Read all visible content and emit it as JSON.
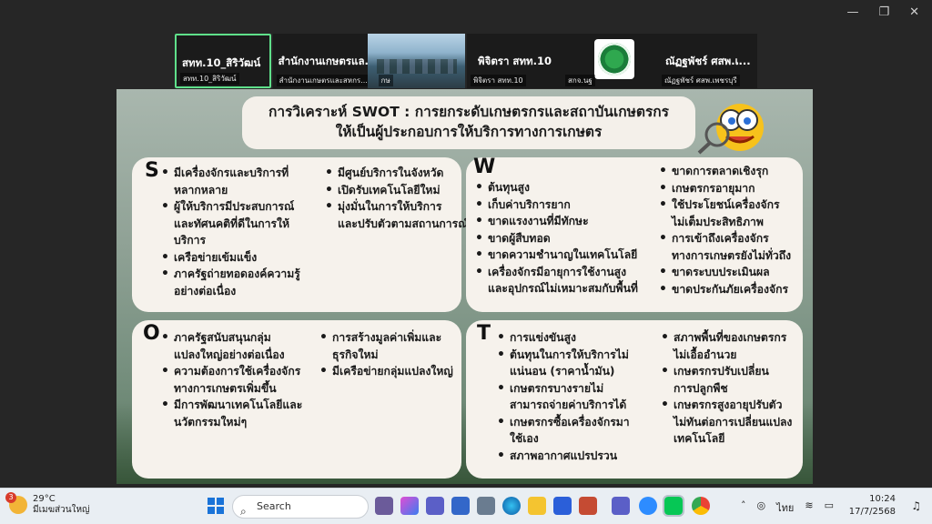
{
  "window": {
    "minimize": "—",
    "maximize": "❐",
    "close": "✕"
  },
  "participants": [
    {
      "name": "สทท.10_สิริวัฒน์",
      "caption": "สทท.10_สิริวัฒน์"
    },
    {
      "name": "สำนักงานเกษตรแล...",
      "caption": "สำนักงานเกษตรและสหกร..."
    },
    {
      "name": "",
      "caption": "กษ"
    },
    {
      "name": "พิจิตรา สทท.10",
      "caption": "พิจิตรา สทท.10"
    },
    {
      "name": "",
      "caption": "สกจ.นฐ"
    },
    {
      "name": "ณัฏฐพัชร์ ศสพ.เ...",
      "caption": "ณัฏฐพัชร์ ศสพ.เพชรบุรี"
    }
  ],
  "slide": {
    "title_line1": "การวิเคราะห์ SWOT : การยกระดับเกษตรกรและสถาบันเกษตรกร",
    "title_line2": "ให้เป็นผู้ประกอบการให้บริการทางการเกษตร",
    "s_letter": "S",
    "s_col1": [
      "มีเครื่องจักรและบริการที่",
      "หลากหลาย",
      "ผู้ให้บริการมีประสบการณ์",
      "และทัศนคติที่ดีในการให้",
      "บริการ",
      "เครือข่ายเข้มแข็ง",
      "ภาครัฐถ่ายทอดองค์ความรู้",
      "อย่างต่อเนื่อง"
    ],
    "s_col2": [
      "มีศูนย์บริการในจังหวัด",
      "เปิดรับเทคโนโลยีใหม่",
      "มุ่งมั่นในการให้บริการ",
      "และปรับตัวตามสถานการณ์"
    ],
    "w_letter": "W",
    "w_col1": [
      "ต้นทุนสูง",
      "เก็บค่าบริการยาก",
      "ขาดแรงงานที่มีทักษะ",
      "ขาดผู้สืบทอด",
      "ขาดความชำนาญในเทคโนโลยี",
      "เครื่องจักรมีอายุการใช้งานสูง",
      "และอุปกรณ์ไม่เหมาะสมกับพื้นที่"
    ],
    "w_col2": [
      "ขาดการตลาดเชิงรุก",
      "เกษตรกรอายุมาก",
      "ใช้ประโยชน์เครื่องจักร",
      "ไม่เต็มประสิทธิภาพ",
      "การเข้าถึงเครื่องจักร",
      "ทางการเกษตรยังไม่ทั่วถึง",
      "ขาดระบบประเมินผล",
      "ขาดประกันภัยเครื่องจักร"
    ],
    "o_letter": "O",
    "o_col1": [
      "ภาครัฐสนับสนุนกลุ่ม",
      "แปลงใหญ่อย่างต่อเนื่อง",
      "ความต้องการใช้เครื่องจักร",
      "ทางการเกษตรเพิ่มขึ้น",
      "มีการพัฒนาเทคโนโลยีและ",
      "นวัตกรรมใหม่ๆ"
    ],
    "o_col2": [
      "การสร้างมูลค่าเพิ่มและ",
      "ธุรกิจใหม่",
      "มีเครือข่ายกลุ่มแปลงใหญ่"
    ],
    "t_letter": "T",
    "t_col1": [
      "การแข่งขันสูง",
      "ต้นทุนในการให้บริการไม่",
      "แน่นอน (ราคาน้ำมัน)",
      "เกษตรกรบางรายไม่",
      "สามารถจ่ายค่าบริการได้",
      "เกษตรกรซื้อเครื่องจักรมา",
      "ใช้เอง",
      "สภาพอากาศแปรปรวน"
    ],
    "t_col2": [
      "สภาพพื้นที่ของเกษตรกร",
      "ไม่เอื้ออำนวย",
      "เกษตรกรปรับเปลี่ยน",
      "การปลูกพืช",
      "เกษตรกรสูงอายุปรับตัว",
      "ไม่ทันต่อการเปลี่ยนแปลง",
      "เทคโนโลยี"
    ]
  },
  "taskbar": {
    "weather_badge": "3",
    "temperature": "29°C",
    "weather_text": "มีเมฆส่วนใหญ่",
    "search_placeholder": "Search",
    "language": "ไทย",
    "time": "10:24",
    "date": "17/7/2568"
  }
}
